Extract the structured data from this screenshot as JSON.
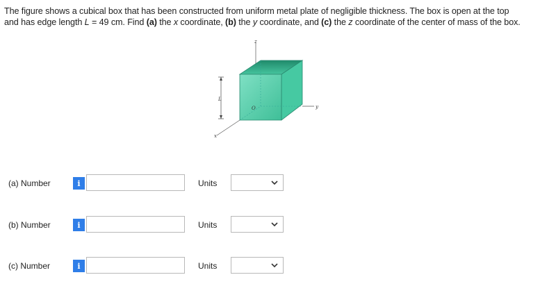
{
  "problem": {
    "line1_a": "The figure shows a cubical box that has been constructed from uniform metal plate of negligible thickness. The box is open at the top",
    "line2_a": "and has edge length ",
    "line2_L": "L",
    "line2_b": " = 49 cm. Find ",
    "part_a": "(a)",
    "line2_c": " the ",
    "x_var": "x",
    "line2_d": " coordinate, ",
    "part_b": "(b)",
    "line2_e": " the ",
    "y_var": "y",
    "line2_f": " coordinate, and ",
    "part_c": "(c)",
    "line2_g": " the ",
    "z_var": "z",
    "line2_h": " coordinate of the center of mass of the box."
  },
  "figure": {
    "z_label": "z",
    "y_label": "y",
    "x_label": "x",
    "o_label": "O",
    "L_label": "L"
  },
  "rows": [
    {
      "label": "(a)   Number",
      "info": "i",
      "value": "",
      "units_label": "Units",
      "units_value": ""
    },
    {
      "label": "(b)   Number",
      "info": "i",
      "value": "",
      "units_label": "Units",
      "units_value": ""
    },
    {
      "label": "(c)   Number",
      "info": "i",
      "value": "",
      "units_label": "Units",
      "units_value": ""
    }
  ],
  "colors": {
    "info_bg": "#2f7ee8",
    "box_front": "#5ccfb0",
    "box_inner": "#2e9f7e"
  }
}
